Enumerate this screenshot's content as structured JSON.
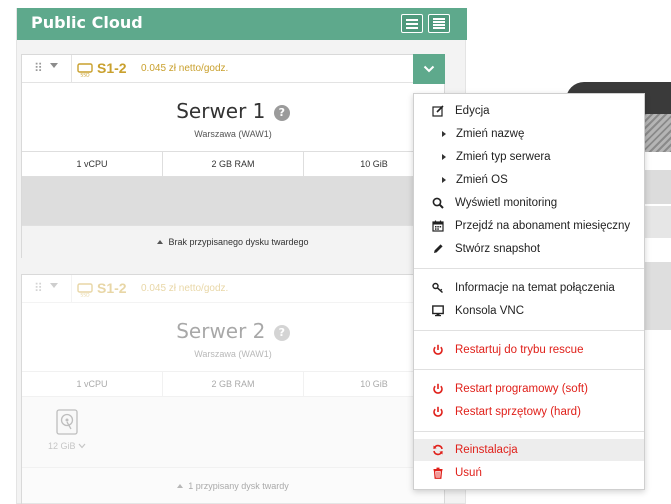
{
  "panel": {
    "title": "Public Cloud"
  },
  "servers": [
    {
      "plan": "S1-2",
      "price": "0.045 zł netto/godz.",
      "name": "Serwer 1",
      "help": "?",
      "location": "Warszawa (WAW1)",
      "specs": [
        "1 vCPU",
        "2 GB RAM",
        "10 GiB"
      ],
      "disk_status": "Brak przypisanego dysku twardego"
    },
    {
      "plan": "S1-2",
      "price": "0.045 zł netto/godz.",
      "name": "Serwer 2",
      "help": "?",
      "location": "Warszawa (WAW1)",
      "specs": [
        "1 vCPU",
        "2 GB RAM",
        "10 GiB"
      ],
      "disk_size": "12 GiB",
      "disk_status": "1 przypisany dysk twardy"
    }
  ],
  "menu": {
    "items": [
      {
        "label": "Edycja",
        "icon": "edit-icon"
      },
      {
        "label": "Zmień nazwę",
        "icon": "caret-right-icon"
      },
      {
        "label": "Zmień typ serwera",
        "icon": "caret-right-icon"
      },
      {
        "label": "Zmień OS",
        "icon": "caret-right-icon"
      },
      {
        "label": "Wyświetl monitoring",
        "icon": "search-icon"
      },
      {
        "label": "Przejdź na abonament miesięczny",
        "icon": "calendar-icon"
      },
      {
        "label": "Stwórz snapshot",
        "icon": "pencil-icon"
      },
      {
        "label": "Informacje na temat połączenia",
        "icon": "key-icon"
      },
      {
        "label": "Konsola VNC",
        "icon": "monitor-icon"
      },
      {
        "label": "Restartuj do trybu rescue",
        "icon": "power-icon"
      },
      {
        "label": "Restart programowy (soft)",
        "icon": "power-icon"
      },
      {
        "label": "Restart sprzętowy (hard)",
        "icon": "power-icon"
      },
      {
        "label": "Reinstalacja",
        "icon": "refresh-icon"
      },
      {
        "label": "Usuń",
        "icon": "trash-icon"
      }
    ]
  },
  "colors": {
    "accent": "#5ea98c",
    "plan": "#c9a02d",
    "danger": "#e0201a"
  }
}
